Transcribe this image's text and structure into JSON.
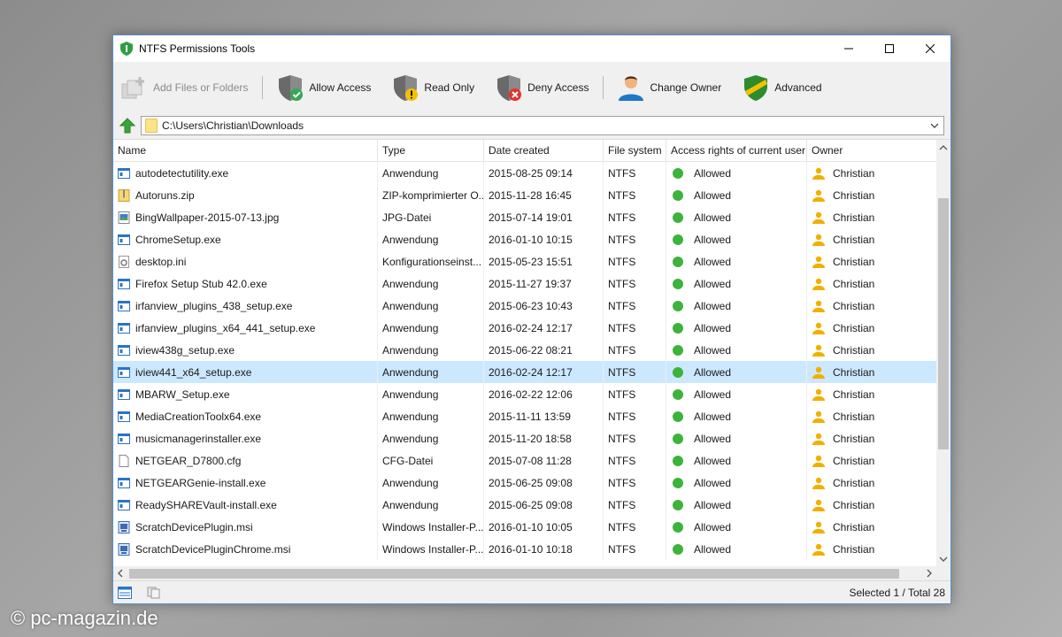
{
  "window": {
    "title": "NTFS Permissions Tools"
  },
  "toolbar": {
    "add_label": "Add Files or Folders",
    "allow_label": "Allow Access",
    "readonly_label": "Read Only",
    "deny_label": "Deny Access",
    "owner_label": "Change Owner",
    "advanced_label": "Advanced"
  },
  "path": {
    "value": "C:\\Users\\Christian\\Downloads"
  },
  "columns": {
    "name": "Name",
    "type": "Type",
    "date": "Date created",
    "fs": "File system",
    "access": "Access rights of current user",
    "owner": "Owner"
  },
  "rows": [
    {
      "name": "autodetectutility.exe",
      "type": "Anwendung",
      "date": "2015-08-25 09:14",
      "fs": "NTFS",
      "access": "Allowed",
      "owner": "Christian",
      "icon": "exe-icon"
    },
    {
      "name": "Autoruns.zip",
      "type": "ZIP-komprimierter O...",
      "date": "2015-11-28 16:45",
      "fs": "NTFS",
      "access": "Allowed",
      "owner": "Christian",
      "icon": "zip-icon"
    },
    {
      "name": "BingWallpaper-2015-07-13.jpg",
      "type": "JPG-Datei",
      "date": "2015-07-14 19:01",
      "fs": "NTFS",
      "access": "Allowed",
      "owner": "Christian",
      "icon": "image-icon"
    },
    {
      "name": "ChromeSetup.exe",
      "type": "Anwendung",
      "date": "2016-01-10 10:15",
      "fs": "NTFS",
      "access": "Allowed",
      "owner": "Christian",
      "icon": "exe-icon"
    },
    {
      "name": "desktop.ini",
      "type": "Konfigurationseinst...",
      "date": "2015-05-23 15:51",
      "fs": "NTFS",
      "access": "Allowed",
      "owner": "Christian",
      "icon": "ini-icon"
    },
    {
      "name": "Firefox Setup Stub 42.0.exe",
      "type": "Anwendung",
      "date": "2015-11-27 19:37",
      "fs": "NTFS",
      "access": "Allowed",
      "owner": "Christian",
      "icon": "exe-icon"
    },
    {
      "name": "irfanview_plugins_438_setup.exe",
      "type": "Anwendung",
      "date": "2015-06-23 10:43",
      "fs": "NTFS",
      "access": "Allowed",
      "owner": "Christian",
      "icon": "exe-icon"
    },
    {
      "name": "irfanview_plugins_x64_441_setup.exe",
      "type": "Anwendung",
      "date": "2016-02-24 12:17",
      "fs": "NTFS",
      "access": "Allowed",
      "owner": "Christian",
      "icon": "exe-icon"
    },
    {
      "name": "iview438g_setup.exe",
      "type": "Anwendung",
      "date": "2015-06-22 08:21",
      "fs": "NTFS",
      "access": "Allowed",
      "owner": "Christian",
      "icon": "exe-icon"
    },
    {
      "name": "iview441_x64_setup.exe",
      "type": "Anwendung",
      "date": "2016-02-24 12:17",
      "fs": "NTFS",
      "access": "Allowed",
      "owner": "Christian",
      "icon": "exe-icon",
      "selected": true
    },
    {
      "name": "MBARW_Setup.exe",
      "type": "Anwendung",
      "date": "2016-02-22 12:06",
      "fs": "NTFS",
      "access": "Allowed",
      "owner": "Christian",
      "icon": "exe-icon"
    },
    {
      "name": "MediaCreationToolx64.exe",
      "type": "Anwendung",
      "date": "2015-11-11 13:59",
      "fs": "NTFS",
      "access": "Allowed",
      "owner": "Christian",
      "icon": "exe-icon"
    },
    {
      "name": "musicmanagerinstaller.exe",
      "type": "Anwendung",
      "date": "2015-11-20 18:58",
      "fs": "NTFS",
      "access": "Allowed",
      "owner": "Christian",
      "icon": "exe-icon"
    },
    {
      "name": "NETGEAR_D7800.cfg",
      "type": "CFG-Datei",
      "date": "2015-07-08 11:28",
      "fs": "NTFS",
      "access": "Allowed",
      "owner": "Christian",
      "icon": "file-icon"
    },
    {
      "name": "NETGEARGenie-install.exe",
      "type": "Anwendung",
      "date": "2015-06-25 09:08",
      "fs": "NTFS",
      "access": "Allowed",
      "owner": "Christian",
      "icon": "exe-icon"
    },
    {
      "name": "ReadySHAREVault-install.exe",
      "type": "Anwendung",
      "date": "2015-06-25 09:08",
      "fs": "NTFS",
      "access": "Allowed",
      "owner": "Christian",
      "icon": "exe-icon"
    },
    {
      "name": "ScratchDevicePlugin.msi",
      "type": "Windows Installer-P...",
      "date": "2016-01-10 10:05",
      "fs": "NTFS",
      "access": "Allowed",
      "owner": "Christian",
      "icon": "msi-icon"
    },
    {
      "name": "ScratchDevicePluginChrome.msi",
      "type": "Windows Installer-P...",
      "date": "2016-01-10 10:18",
      "fs": "NTFS",
      "access": "Allowed",
      "owner": "Christian",
      "icon": "msi-icon"
    }
  ],
  "status": {
    "text": "Selected 1 / Total 28"
  },
  "watermark": "© pc-magazin.de",
  "colors": {
    "selected_row": "#cce8ff",
    "allowed_dot": "#3cb33c",
    "window_border": "#5a8fc7"
  }
}
